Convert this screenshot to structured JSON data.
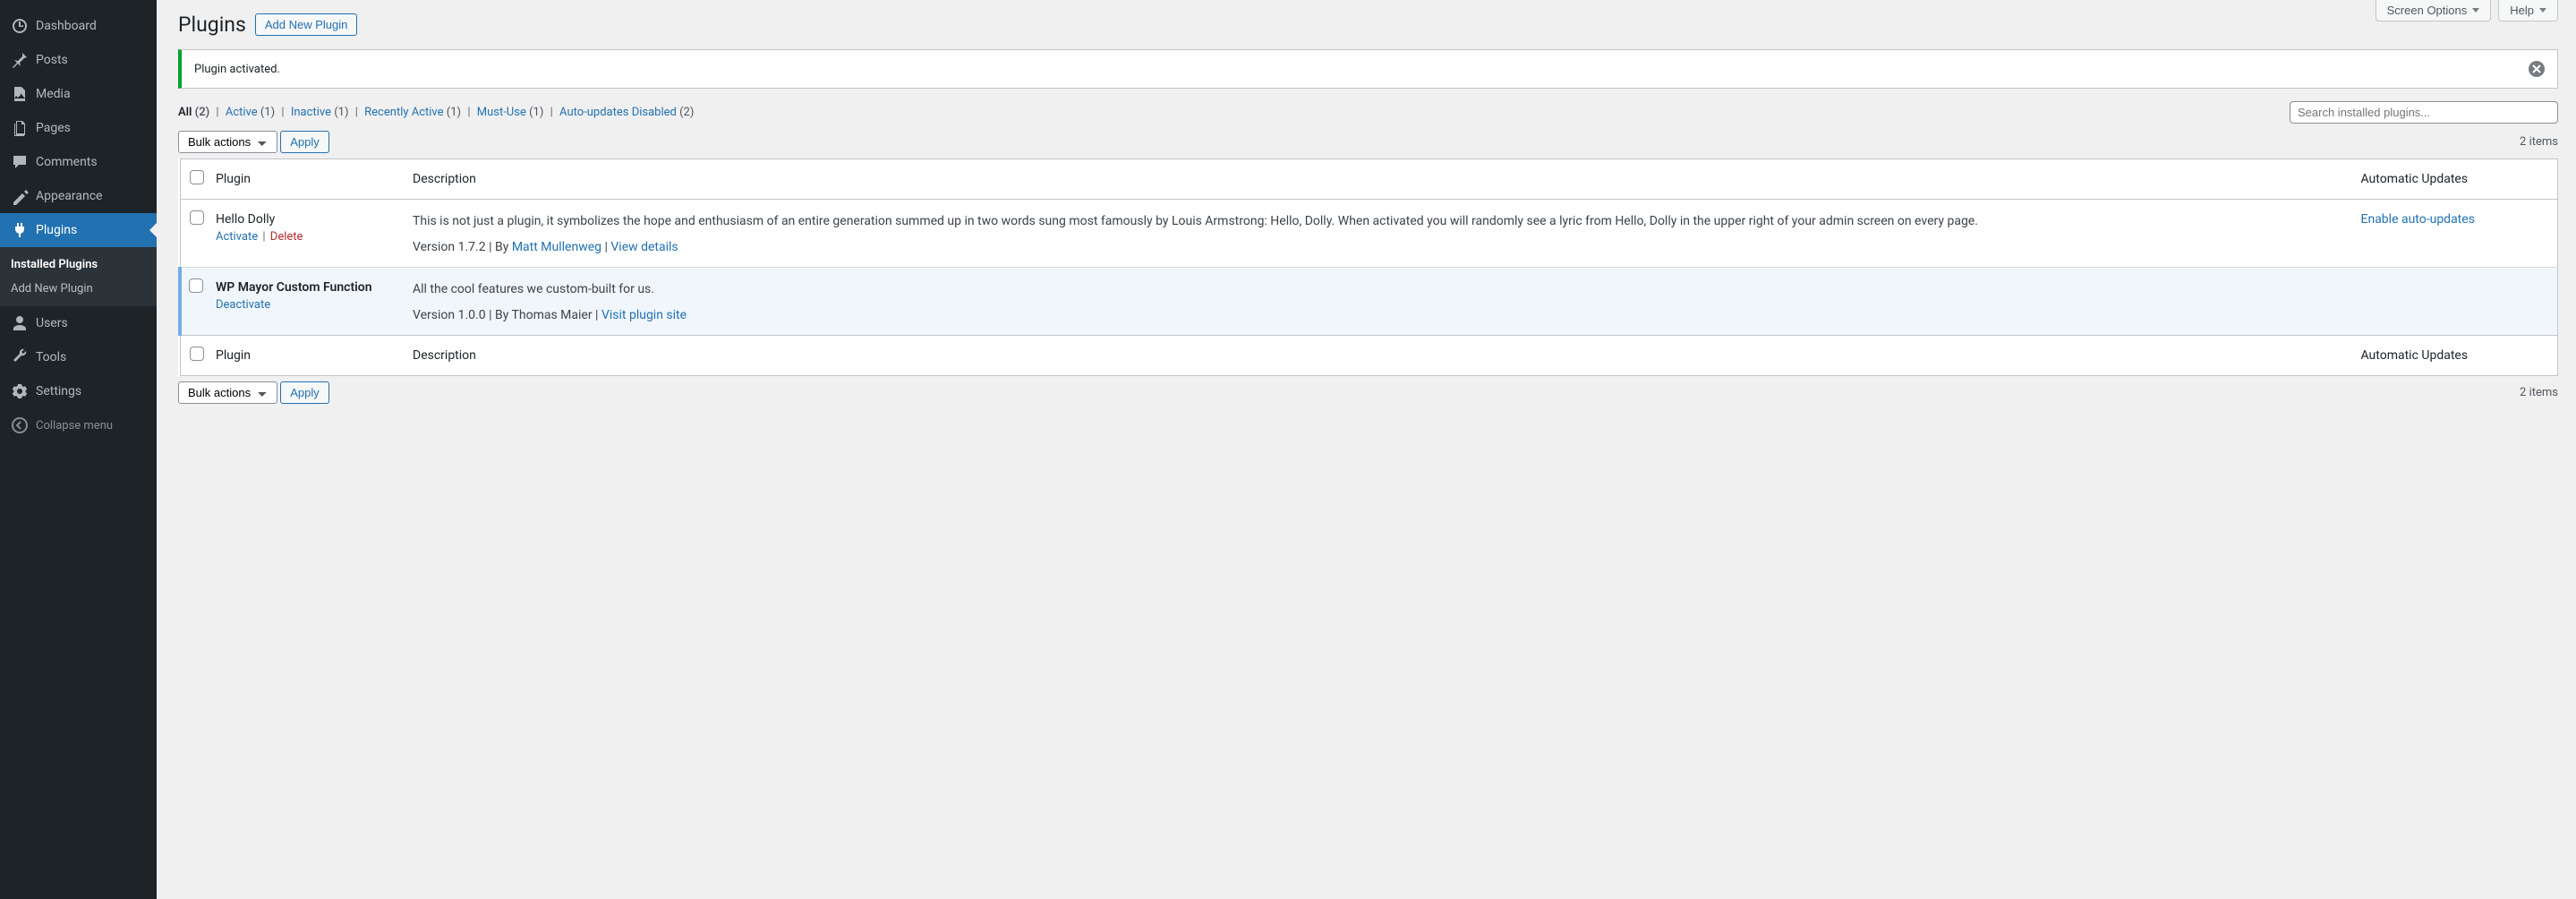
{
  "sidebar": {
    "items": [
      {
        "label": "Dashboard"
      },
      {
        "label": "Posts"
      },
      {
        "label": "Media"
      },
      {
        "label": "Pages"
      },
      {
        "label": "Comments"
      },
      {
        "label": "Appearance"
      },
      {
        "label": "Plugins"
      },
      {
        "label": "Users"
      },
      {
        "label": "Tools"
      },
      {
        "label": "Settings"
      }
    ],
    "submenu": {
      "installed": "Installed Plugins",
      "addnew": "Add New Plugin"
    },
    "collapse": "Collapse menu"
  },
  "topbar": {
    "screen_options": "Screen Options",
    "help": "Help"
  },
  "header": {
    "title": "Plugins",
    "add_new": "Add New Plugin"
  },
  "notice": {
    "text": "Plugin activated."
  },
  "filters": {
    "all_label": "All",
    "all_count": "(2)",
    "active_label": "Active",
    "active_count": "(1)",
    "inactive_label": "Inactive",
    "inactive_count": "(1)",
    "recent_label": "Recently Active",
    "recent_count": "(1)",
    "mustuse_label": "Must-Use",
    "mustuse_count": "(1)",
    "autoupd_label": "Auto-updates Disabled",
    "autoupd_count": "(2)"
  },
  "search": {
    "placeholder": "Search installed plugins..."
  },
  "bulk": {
    "label": "Bulk actions",
    "apply": "Apply"
  },
  "items_count": "2 items",
  "table": {
    "col_plugin": "Plugin",
    "col_desc": "Description",
    "col_auto": "Automatic Updates"
  },
  "plugins": [
    {
      "name": "Hello Dolly",
      "active": false,
      "actions": {
        "activate": "Activate",
        "delete": "Delete"
      },
      "desc": "This is not just a plugin, it symbolizes the hope and enthusiasm of an entire generation summed up in two words sung most famously by Louis Armstrong: Hello, Dolly. When activated you will randomly see a lyric from Hello, Dolly in the upper right of your admin screen on every page.",
      "meta_version": "Version 1.7.2",
      "meta_by": "By",
      "meta_author": "Matt Mullenweg",
      "meta_details": "View details",
      "auto_update": "Enable auto-updates"
    },
    {
      "name": "WP Mayor Custom Function",
      "active": true,
      "actions": {
        "deactivate": "Deactivate"
      },
      "desc": "All the cool features we custom-built for us.",
      "meta_version": "Version 1.0.0",
      "meta_by": "By Thomas Maier",
      "meta_site": "Visit plugin site",
      "auto_update": ""
    }
  ]
}
